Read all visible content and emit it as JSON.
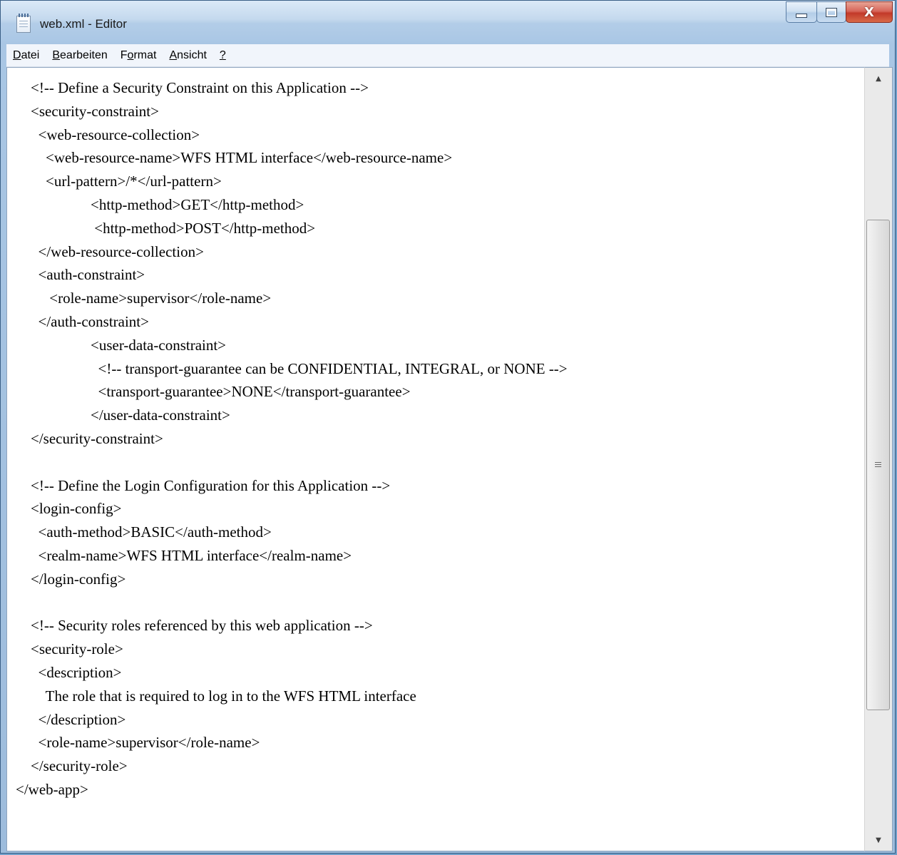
{
  "window": {
    "title": "web.xml - Editor",
    "controls": {
      "minimize": "—",
      "maximize": "□",
      "close": "X"
    }
  },
  "menu": [
    {
      "prefix": "",
      "underlined": "D",
      "rest": "atei"
    },
    {
      "prefix": "",
      "underlined": "B",
      "rest": "earbeiten"
    },
    {
      "prefix": "F",
      "underlined": "o",
      "rest": "rmat"
    },
    {
      "prefix": "",
      "underlined": "A",
      "rest": "nsicht"
    },
    {
      "prefix": "",
      "underlined": "?",
      "rest": ""
    }
  ],
  "editor": {
    "lines": [
      "<!-- Define a Security Constraint on this Application -->",
      "<security-constraint>",
      "  <web-resource-collection>",
      "    <web-resource-name>WFS HTML interface</web-resource-name>",
      "    <url-pattern>/*</url-pattern>",
      "                <http-method>GET</http-method>",
      "                 <http-method>POST</http-method>",
      "  </web-resource-collection>",
      "  <auth-constraint>",
      "     <role-name>supervisor</role-name>",
      "  </auth-constraint>",
      "                <user-data-constraint>",
      "                  <!-- transport-guarantee can be CONFIDENTIAL, INTEGRAL, or NONE -->",
      "                  <transport-guarantee>NONE</transport-guarantee>",
      "                </user-data-constraint>",
      "</security-constraint>",
      "",
      "<!-- Define the Login Configuration for this Application -->",
      "<login-config>",
      "  <auth-method>BASIC</auth-method>",
      "  <realm-name>WFS HTML interface</realm-name>",
      "</login-config>",
      "",
      "<!-- Security roles referenced by this web application -->",
      "<security-role>",
      "  <description>",
      "    The role that is required to log in to the WFS HTML interface",
      "  </description>",
      "  <role-name>supervisor</role-name>",
      "</security-role>",
      "</web-app>"
    ]
  },
  "scrollbar": {
    "position": 0.52,
    "up_arrow": "▲",
    "down_arrow": "▼"
  }
}
